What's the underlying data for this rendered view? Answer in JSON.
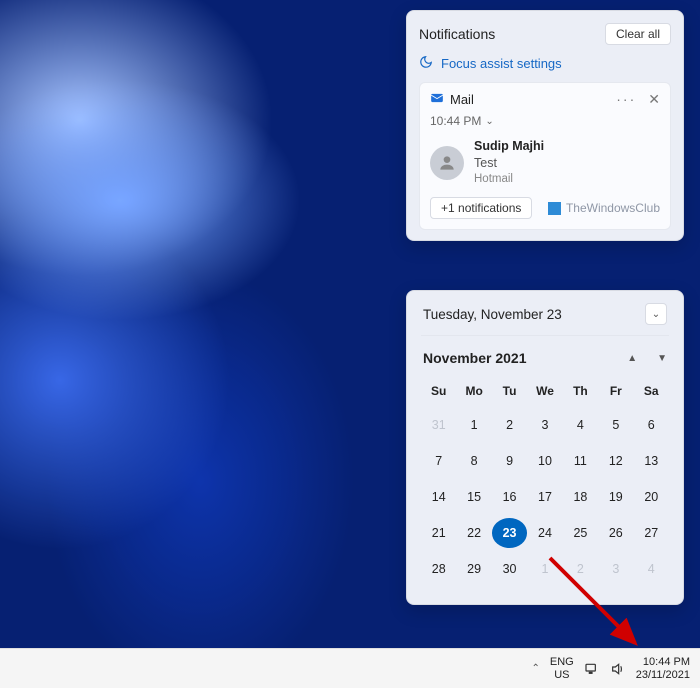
{
  "notifications": {
    "title": "Notifications",
    "clear_all": "Clear all",
    "focus_link": "Focus assist settings",
    "card": {
      "app": "Mail",
      "time": "10:44 PM",
      "sender": "Sudip Majhi",
      "subject": "Test",
      "account": "Hotmail",
      "more_button": "+1 notifications"
    },
    "watermark": "TheWindowsClub"
  },
  "calendar": {
    "header_date": "Tuesday, November 23",
    "month_label": "November 2021",
    "weekdays": [
      "Su",
      "Mo",
      "Tu",
      "We",
      "Th",
      "Fr",
      "Sa"
    ],
    "weeks": [
      [
        {
          "d": "31",
          "dim": true
        },
        {
          "d": "1"
        },
        {
          "d": "2"
        },
        {
          "d": "3"
        },
        {
          "d": "4"
        },
        {
          "d": "5"
        },
        {
          "d": "6"
        }
      ],
      [
        {
          "d": "7"
        },
        {
          "d": "8"
        },
        {
          "d": "9"
        },
        {
          "d": "10"
        },
        {
          "d": "11"
        },
        {
          "d": "12"
        },
        {
          "d": "13"
        }
      ],
      [
        {
          "d": "14"
        },
        {
          "d": "15"
        },
        {
          "d": "16"
        },
        {
          "d": "17"
        },
        {
          "d": "18"
        },
        {
          "d": "19"
        },
        {
          "d": "20"
        }
      ],
      [
        {
          "d": "21"
        },
        {
          "d": "22"
        },
        {
          "d": "23",
          "today": true
        },
        {
          "d": "24"
        },
        {
          "d": "25"
        },
        {
          "d": "26"
        },
        {
          "d": "27"
        }
      ],
      [
        {
          "d": "28"
        },
        {
          "d": "29"
        },
        {
          "d": "30"
        },
        {
          "d": "1",
          "dim": true
        },
        {
          "d": "2",
          "dim": true
        },
        {
          "d": "3",
          "dim": true
        },
        {
          "d": "4",
          "dim": true
        }
      ]
    ]
  },
  "taskbar": {
    "lang_top": "ENG",
    "lang_bottom": "US",
    "clock_time": "10:44 PM",
    "clock_date": "23/11/2021"
  }
}
